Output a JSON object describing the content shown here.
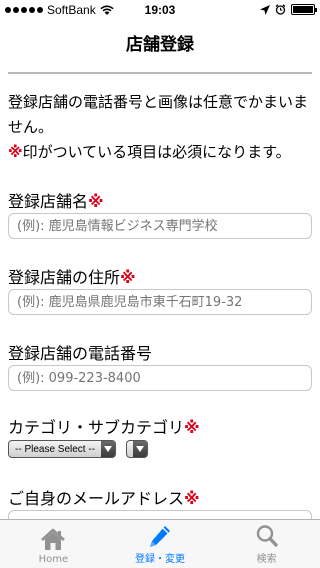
{
  "status_bar": {
    "carrier": "SoftBank",
    "time": "19:03"
  },
  "nav": {
    "title": "店舗登録"
  },
  "intro": {
    "line1": "登録店舗の電話番号と画像は任意でかまいません。",
    "required_mark": "※",
    "required_note": "印がついている項目は必須になります。"
  },
  "form": {
    "store_name_label": "登録店舗名",
    "store_name_placeholder": "(例): 鹿児島情報ビジネス専門学校",
    "address_label": "登録店舗の住所",
    "address_placeholder": "(例): 鹿児島県鹿児島市東千石町19-32",
    "phone_label": "登録店舗の電話番号",
    "phone_placeholder": "(例): 099-223-8400",
    "category_label": "カテゴリ・サブカテゴリ",
    "category_select": "-- Please Select --",
    "subcategory_select": "",
    "email_label": "ご自身のメールアドレス",
    "required_mark": "※"
  },
  "tabs": [
    {
      "label": "Home",
      "icon": "home-icon"
    },
    {
      "label": "登録・変更",
      "icon": "pencil-icon"
    },
    {
      "label": "検索",
      "icon": "search-icon"
    }
  ],
  "colors": {
    "accent": "#007aff",
    "required": "#e0001a",
    "tab_inactive": "#929292"
  }
}
